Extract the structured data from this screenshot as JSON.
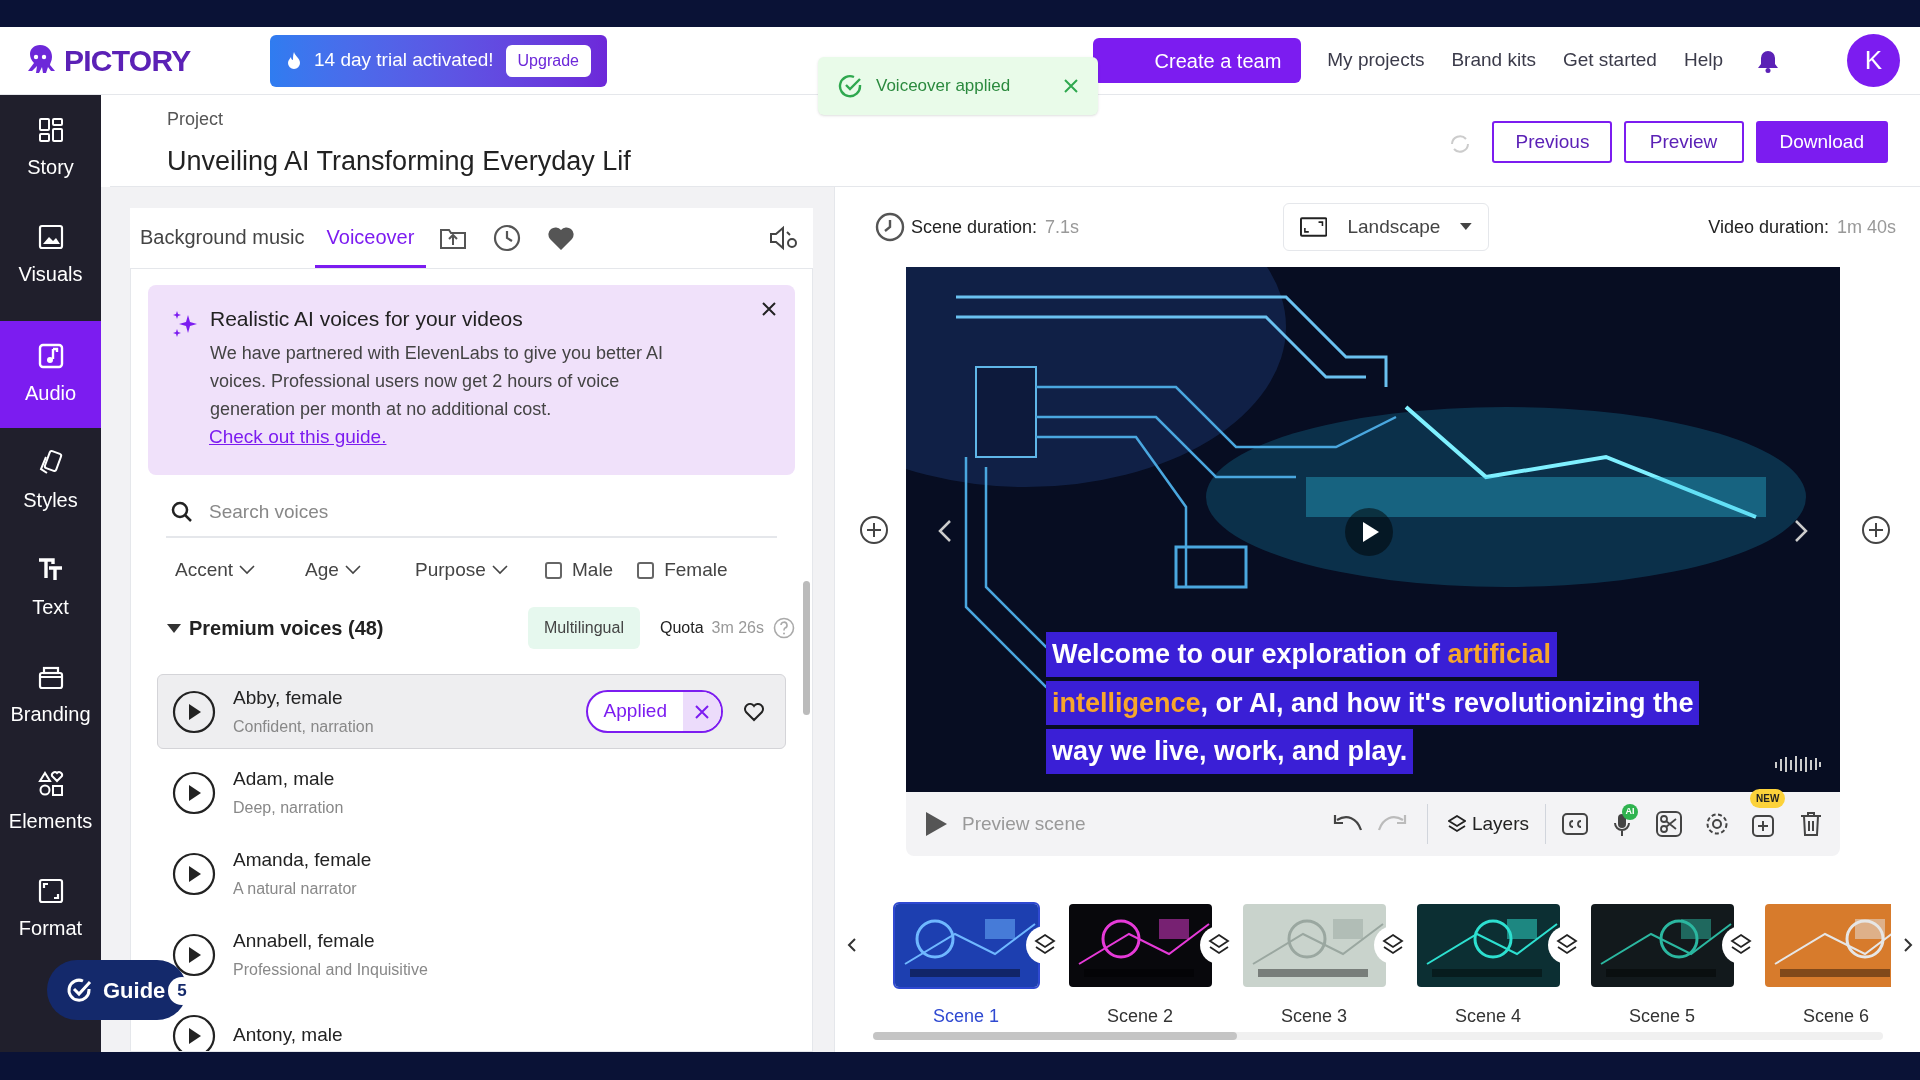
{
  "topbar": {
    "logo": "PICTORY",
    "trial": {
      "text": "14 day trial activated!",
      "button": "Upgrade"
    },
    "create_team": "Create a team",
    "links": [
      "My projects",
      "Brand kits",
      "Get started",
      "Help"
    ],
    "avatar": "K"
  },
  "toast": {
    "text": "Voiceover applied"
  },
  "sidebar": {
    "items": [
      {
        "label": "Story",
        "selected": false
      },
      {
        "label": "Visuals",
        "selected": false
      },
      {
        "label": "Audio",
        "selected": true
      },
      {
        "label": "Styles",
        "selected": false
      },
      {
        "label": "Text",
        "selected": false
      },
      {
        "label": "Branding",
        "selected": false
      },
      {
        "label": "Elements",
        "selected": false
      },
      {
        "label": "Format",
        "selected": false
      }
    ]
  },
  "guide": {
    "label": "Guide",
    "count": "5"
  },
  "project": {
    "caption": "Project",
    "title": "Unveiling AI Transforming Everyday Lif",
    "buttons": [
      "Previous",
      "Preview",
      "Download"
    ]
  },
  "audio_panel": {
    "tabs": [
      {
        "label": "Background music",
        "selected": false
      },
      {
        "label": "Voiceover",
        "selected": true
      }
    ],
    "promo": {
      "title": "Realistic AI voices for your videos",
      "body": "We have partnered with ElevenLabs to give you better AI voices. Professional users now get 2 hours of voice generation per month at no additional cost.",
      "link": "Check out this guide."
    },
    "search": {
      "placeholder": "Search voices"
    },
    "filters": [
      {
        "label": "Accent"
      },
      {
        "label": "Age"
      },
      {
        "label": "Purpose"
      }
    ],
    "checkboxes": [
      {
        "label": "Male",
        "checked": false
      },
      {
        "label": "Female",
        "checked": false
      }
    ],
    "section": {
      "title": "Premium voices (48)",
      "expanded": true,
      "tag": "Multilingual",
      "quota_label": "Quota",
      "quota_value": "3m 26s"
    },
    "voices": [
      {
        "name": "Abby, female",
        "description": "Confident, narration",
        "selected": true,
        "applied": true,
        "applied_label": "Applied"
      },
      {
        "name": "Adam, male",
        "description": "Deep, narration",
        "selected": false,
        "applied": false
      },
      {
        "name": "Amanda, female",
        "description": "A natural narrator",
        "selected": false,
        "applied": false
      },
      {
        "name": "Annabell, female",
        "description": "Professional and Inquisitive",
        "selected": false,
        "applied": false
      },
      {
        "name": "Antony, male",
        "selected": false,
        "applied": false
      }
    ]
  },
  "editor": {
    "scene_duration": {
      "label": "Scene duration:",
      "value": "7.1s"
    },
    "orientation": "Landscape",
    "video_duration": {
      "label": "Video duration:",
      "value": "1m 40s"
    },
    "caption": [
      [
        {
          "text": "Welcome to our exploration of ",
          "highlight": false
        },
        {
          "text": "artificial",
          "highlight": true
        }
      ],
      [
        {
          "text": "intelligence",
          "highlight": true
        },
        {
          "text": ", or AI, and how it's revolutionizing the",
          "highlight": false
        }
      ],
      [
        {
          "text": "way we live, work, and play.",
          "highlight": false
        }
      ]
    ],
    "toolbar": {
      "preview": "Preview scene",
      "layers": "Layers",
      "ai_badge": "AI",
      "new_badge": "NEW"
    },
    "scenes": [
      {
        "label": "Scene 1",
        "selected": true
      },
      {
        "label": "Scene 2",
        "selected": false
      },
      {
        "label": "Scene 3",
        "selected": false
      },
      {
        "label": "Scene 4",
        "selected": false
      },
      {
        "label": "Scene 5",
        "selected": false
      },
      {
        "label": "Scene 6",
        "selected": false
      }
    ]
  }
}
